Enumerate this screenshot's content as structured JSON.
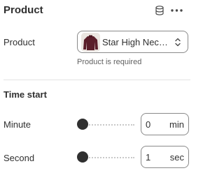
{
  "header": {
    "title": "Product",
    "icons": [
      "database-icon",
      "more-icon"
    ]
  },
  "product": {
    "label": "Product",
    "selected": "Star High Neck Cropped Sweater",
    "helper": "Product is required",
    "thumb_color": "#5a1e2a"
  },
  "time_start": {
    "title": "Time start",
    "minute": {
      "label": "Minute",
      "value": "0",
      "unit": "min"
    },
    "second": {
      "label": "Second",
      "value": "1",
      "unit": "sec"
    }
  },
  "colors": {
    "text": "#303030",
    "muted": "#616161",
    "border": "#8a8a8a",
    "divider": "#e3e3e3"
  }
}
